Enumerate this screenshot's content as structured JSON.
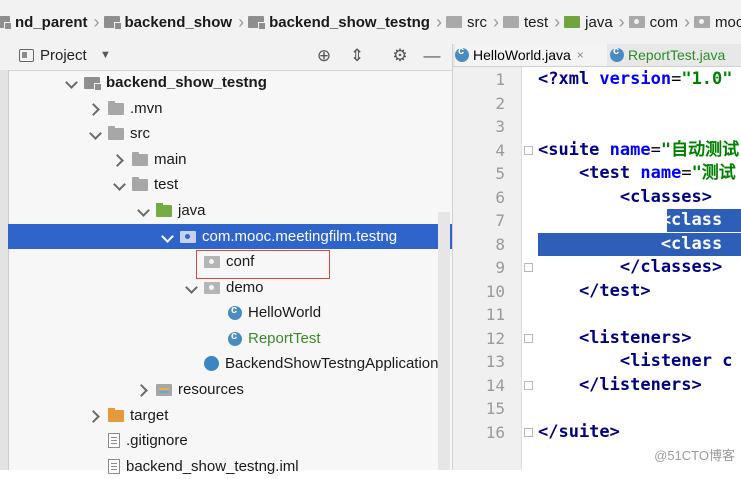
{
  "breadcrumbs": [
    {
      "label": "nd_parent",
      "icon": "module-icon",
      "bold": true
    },
    {
      "label": "backend_show",
      "icon": "module-icon",
      "bold": true
    },
    {
      "label": "backend_show_testng",
      "icon": "module-icon",
      "bold": true
    },
    {
      "label": "src",
      "icon": "folder-icon",
      "bold": false
    },
    {
      "label": "test",
      "icon": "folder-icon",
      "bold": false
    },
    {
      "label": "java",
      "icon": "source-folder-icon",
      "bold": false
    },
    {
      "label": "com",
      "icon": "package-icon",
      "bold": false
    },
    {
      "label": "mooc",
      "icon": "package-icon",
      "bold": false
    }
  ],
  "project_panel": {
    "title": "Project",
    "tree": [
      {
        "label": "backend_show_testng",
        "icon": "module",
        "arrow": "down",
        "bold": true
      },
      {
        "label": ".mvn",
        "icon": "folder",
        "arrow": "right"
      },
      {
        "label": "src",
        "icon": "folder",
        "arrow": "down"
      },
      {
        "label": "main",
        "icon": "folder",
        "arrow": "right"
      },
      {
        "label": "test",
        "icon": "folder",
        "arrow": "down"
      },
      {
        "label": "java",
        "icon": "src",
        "arrow": "down"
      },
      {
        "label": "com.mooc.meetingfilm.testng",
        "icon": "pkg",
        "arrow": "down",
        "selected": true
      },
      {
        "label": "conf",
        "icon": "pkg",
        "arrow": "none",
        "highlighted": true
      },
      {
        "label": "demo",
        "icon": "pkg",
        "arrow": "down"
      },
      {
        "label": "HelloWorld",
        "icon": "cls",
        "arrow": "none"
      },
      {
        "label": "ReportTest",
        "icon": "cls",
        "arrow": "none",
        "green": true
      },
      {
        "label": "BackendShowTestngApplicationT",
        "icon": "app",
        "arrow": "none"
      },
      {
        "label": "resources",
        "icon": "res",
        "arrow": "right"
      },
      {
        "label": "target",
        "icon": "target",
        "arrow": "right"
      },
      {
        "label": ".gitignore",
        "icon": "file",
        "arrow": "none"
      },
      {
        "label": "backend_show_testng.iml",
        "icon": "file",
        "arrow": "none"
      }
    ]
  },
  "editor": {
    "tabs": [
      {
        "label": "HelloWorld.java",
        "close": "×",
        "active": true
      },
      {
        "label": "ReportTest.java",
        "close": "",
        "active": false
      }
    ],
    "line_numbers": [
      "1",
      "2",
      "3",
      "4",
      "5",
      "6",
      "7",
      "8",
      "9",
      "10",
      "11",
      "12",
      "13",
      "14",
      "15",
      "16"
    ],
    "lines": [
      {
        "parts": [
          [
            "t",
            "<?xml "
          ],
          [
            "a",
            "version"
          ],
          [
            "p",
            "="
          ],
          [
            "v",
            "\"1.0\""
          ]
        ]
      },
      {
        "parts": []
      },
      {
        "parts": []
      },
      {
        "parts": [
          [
            "t",
            "<suite "
          ],
          [
            "a",
            "name"
          ],
          [
            "p",
            "="
          ],
          [
            "v",
            "\"自动测试"
          ]
        ]
      },
      {
        "parts": [
          [
            "t",
            "    <test "
          ],
          [
            "a",
            "name"
          ],
          [
            "p",
            "="
          ],
          [
            "v",
            "\"测试"
          ]
        ]
      },
      {
        "parts": [
          [
            "t",
            "        <classes>"
          ]
        ]
      },
      {
        "parts": [
          [
            "t",
            "            <class "
          ]
        ],
        "selected": true
      },
      {
        "parts": [
          [
            "t",
            "            <class "
          ]
        ],
        "selected": true
      },
      {
        "parts": [
          [
            "t",
            "        </classes>"
          ]
        ]
      },
      {
        "parts": [
          [
            "t",
            "    </test>"
          ]
        ]
      },
      {
        "parts": []
      },
      {
        "parts": [
          [
            "t",
            "    <listeners>"
          ]
        ]
      },
      {
        "parts": [
          [
            "t",
            "        <listener c"
          ]
        ]
      },
      {
        "parts": [
          [
            "t",
            "    </listeners>"
          ]
        ]
      },
      {
        "parts": []
      },
      {
        "parts": [
          [
            "t",
            "</suite>"
          ]
        ]
      }
    ]
  },
  "watermark": "@51CTO博客",
  "colors": {
    "selection": "#2f65ca",
    "green_text": "#3c8a2c",
    "highlight_box": "#e04545"
  }
}
